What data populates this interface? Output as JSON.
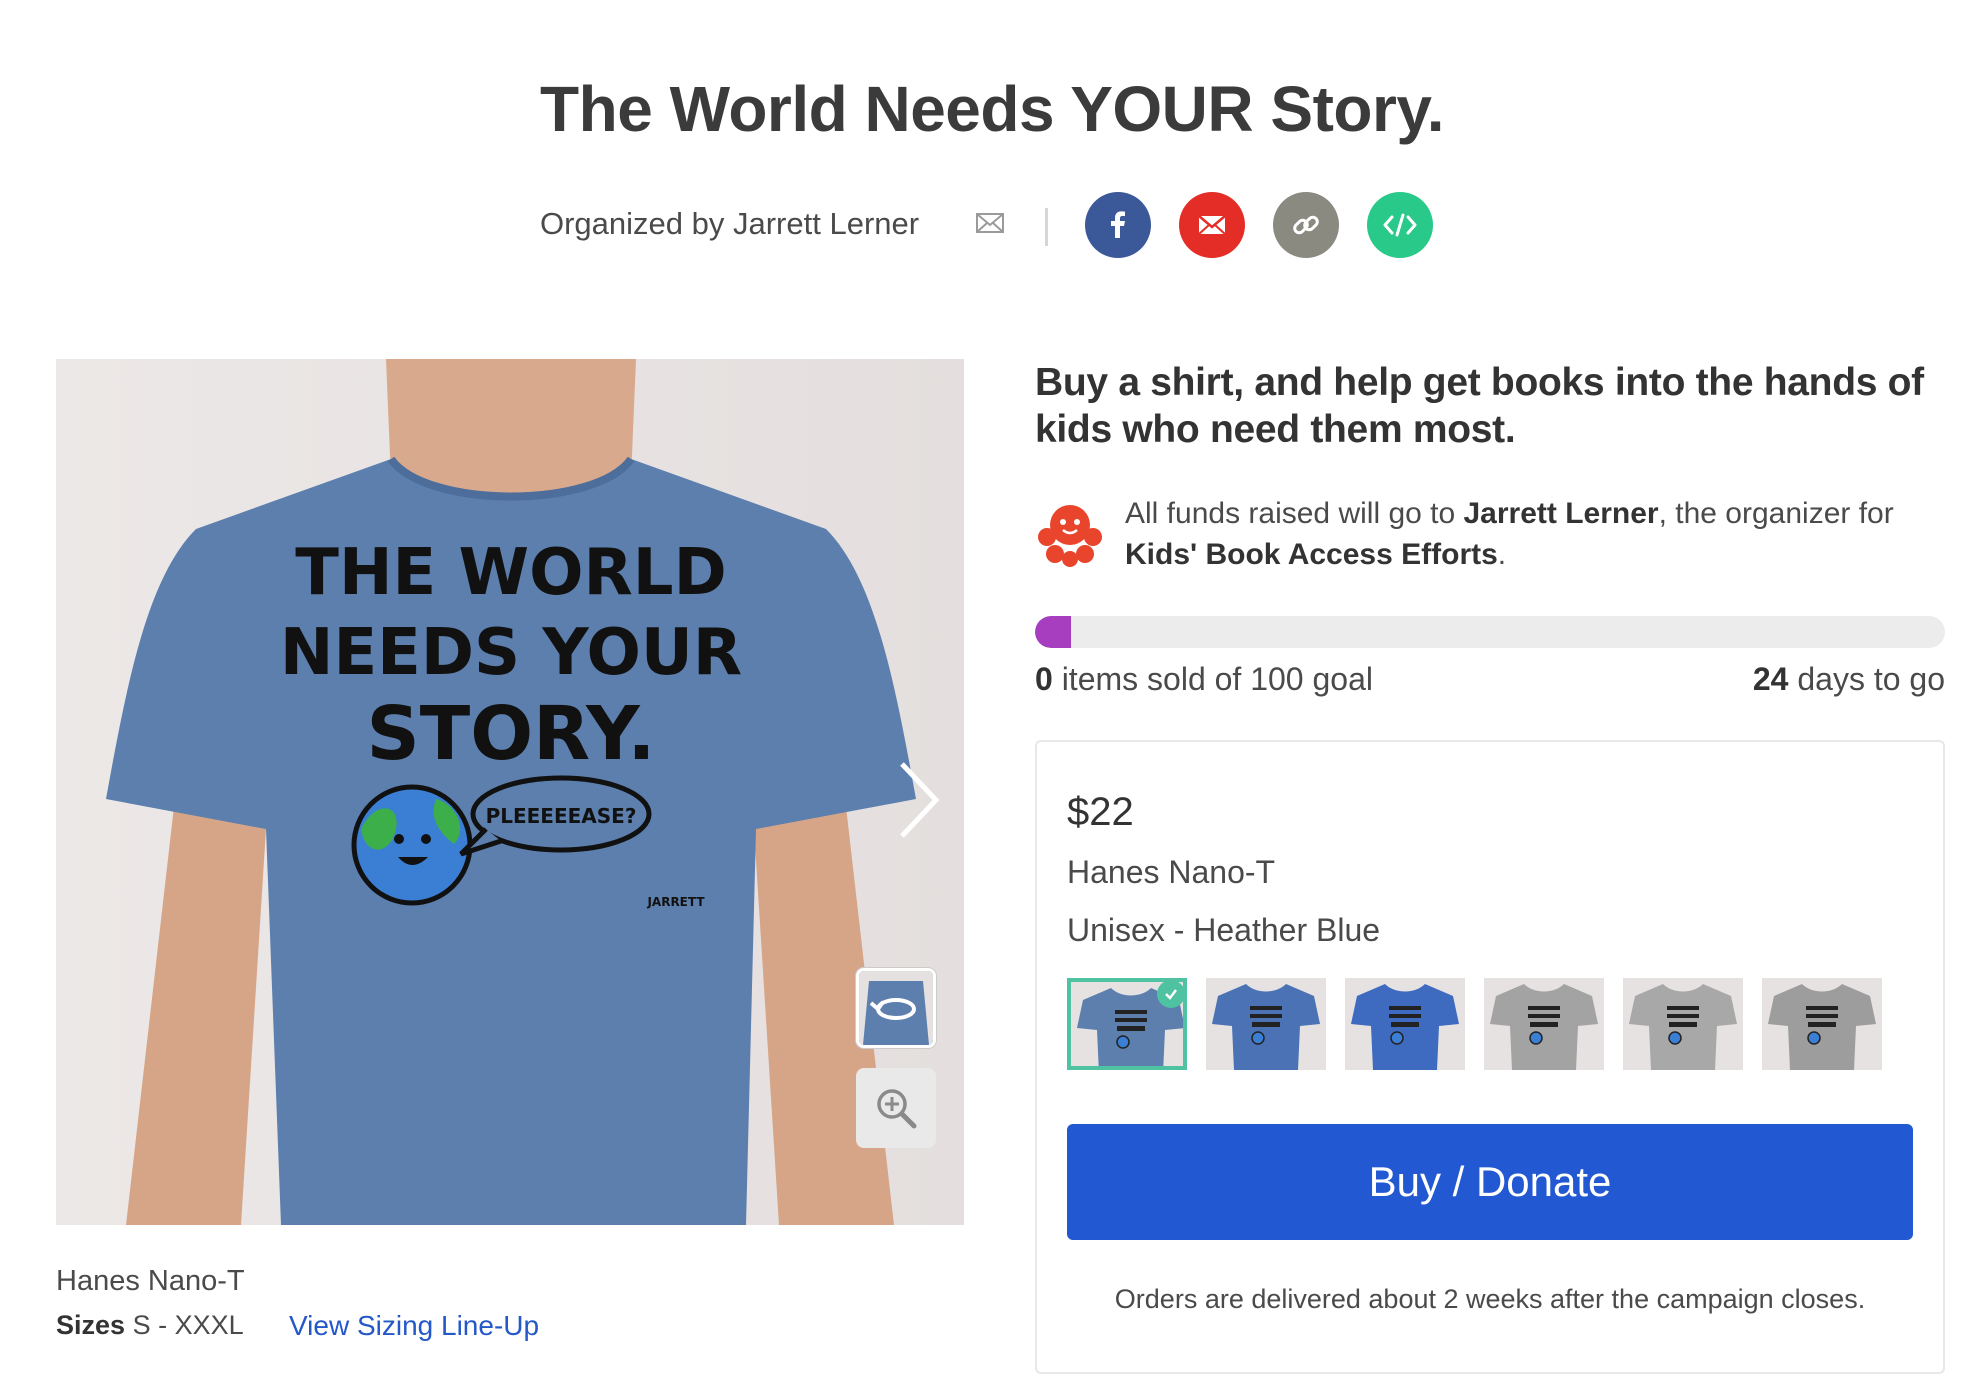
{
  "campaign": {
    "title": "The World Needs YOUR Story.",
    "organized_by": "Organized by Jarrett Lerner"
  },
  "share": {
    "buttons": [
      {
        "name": "facebook",
        "color": "#3b5998",
        "icon": "facebook-icon"
      },
      {
        "name": "email",
        "color": "#e52d27",
        "icon": "mail-icon"
      },
      {
        "name": "link",
        "color": "#8a8a80",
        "icon": "link-icon"
      },
      {
        "name": "embed",
        "color": "#29c98a",
        "icon": "code-icon"
      }
    ]
  },
  "product_image": {
    "shirt_text": [
      "THE WORLD",
      "NEEDS YOUR",
      "STORY."
    ],
    "speech_bubble": "PLEEEEEASE?",
    "signature": "JARRETT",
    "shirt_color": "#5c7fae"
  },
  "product_info": {
    "name": "Hanes Nano-T",
    "sizes_label": "Sizes",
    "sizes_value": "S - XXXL",
    "sizing_link": "View Sizing Line-Up"
  },
  "pitch": {
    "headline": "Buy a shirt, and help get books into the hands of kids who need them most.",
    "funds_prefix": "All funds raised will go to ",
    "funds_recipient": "Jarrett Lerner",
    "funds_middle": ", the organizer for ",
    "funds_cause": "Kids' Book Access Efforts",
    "funds_suffix": "."
  },
  "progress": {
    "fraction": 0.04,
    "sold_count": "0",
    "sold_text": " items sold of 100 goal",
    "days_count": "24",
    "days_text": " days to go",
    "fill_color": "#a63ebf"
  },
  "buy": {
    "price": "$22",
    "style": "Hanes Nano-T",
    "variant": "Unisex - Heather Blue",
    "swatches": [
      {
        "name": "heather-blue-tee",
        "color": "#5c7fae",
        "selected": true
      },
      {
        "name": "blue-womens-vneck",
        "color": "#4a72b5",
        "selected": false
      },
      {
        "name": "blue-long-sleeve",
        "color": "#3e6bbf",
        "selected": false
      },
      {
        "name": "grey-tee",
        "color": "#a3a3a3",
        "selected": false
      },
      {
        "name": "grey-womens-tee",
        "color": "#a8a8a8",
        "selected": false
      },
      {
        "name": "grey-long-sleeve",
        "color": "#9d9d9d",
        "selected": false
      }
    ],
    "button_label": "Buy / Donate",
    "delivery_note": "Orders are delivered about 2 weeks after the campaign closes."
  }
}
